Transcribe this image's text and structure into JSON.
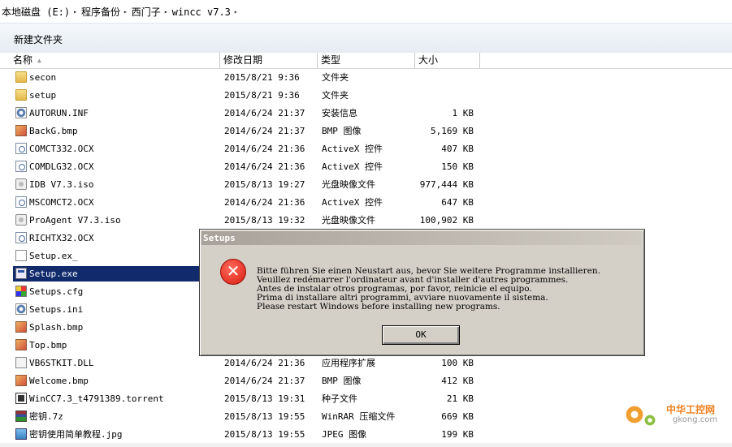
{
  "breadcrumb": [
    "本地磁盘 (E:)",
    "程序备份",
    "西门子",
    "wincc v7.3"
  ],
  "toolbar": {
    "new_folder": "新建文件夹"
  },
  "columns": {
    "name": "名称",
    "date": "修改日期",
    "type": "类型",
    "size": "大小"
  },
  "files": [
    {
      "name": "secon",
      "date": "2015/8/21 9:36",
      "type": "文件夹",
      "size": "",
      "icon": "folder-icon"
    },
    {
      "name": "setup",
      "date": "2015/8/21 9:36",
      "type": "文件夹",
      "size": "",
      "icon": "folder-icon"
    },
    {
      "name": "AUTORUN.INF",
      "date": "2014/6/24 21:37",
      "type": "安装信息",
      "size": "1 KB",
      "icon": "settings-file-icon"
    },
    {
      "name": "BackG.bmp",
      "date": "2014/6/24 21:37",
      "type": "BMP 图像",
      "size": "5,169 KB",
      "icon": "image-file-icon"
    },
    {
      "name": "COMCT332.OCX",
      "date": "2014/6/24 21:36",
      "type": "ActiveX 控件",
      "size": "407 KB",
      "icon": "activex-file-icon"
    },
    {
      "name": "COMDLG32.OCX",
      "date": "2014/6/24 21:36",
      "type": "ActiveX 控件",
      "size": "150 KB",
      "icon": "activex-file-icon"
    },
    {
      "name": "IDB V7.3.iso",
      "date": "2015/8/13 19:27",
      "type": "光盘映像文件",
      "size": "977,444 KB",
      "icon": "disc-image-icon"
    },
    {
      "name": "MSCOMCT2.OCX",
      "date": "2014/6/24 21:36",
      "type": "ActiveX 控件",
      "size": "647 KB",
      "icon": "activex-file-icon"
    },
    {
      "name": "ProAgent V7.3.iso",
      "date": "2015/8/13 19:32",
      "type": "光盘映像文件",
      "size": "100,902 KB",
      "icon": "disc-image-icon"
    },
    {
      "name": "RICHTX32.OCX",
      "date": "",
      "type": "",
      "size": "",
      "icon": "activex-file-icon"
    },
    {
      "name": "Setup.ex_",
      "date": "",
      "type": "",
      "size": "",
      "icon": "blank-file-icon"
    },
    {
      "name": "Setup.exe",
      "date": "",
      "type": "",
      "size": "",
      "icon": "exe-file-icon",
      "selected": true
    },
    {
      "name": "Setups.cfg",
      "date": "",
      "type": "",
      "size": "",
      "icon": "config-file-icon"
    },
    {
      "name": "Setups.ini",
      "date": "",
      "type": "",
      "size": "",
      "icon": "settings-file-icon"
    },
    {
      "name": "Splash.bmp",
      "date": "",
      "type": "",
      "size": "",
      "icon": "image-file-icon"
    },
    {
      "name": "Top.bmp",
      "date": "",
      "type": "",
      "size": "",
      "icon": "image-file-icon"
    },
    {
      "name": "VB6STKIT.DLL",
      "date": "2014/6/24 21:36",
      "type": "应用程序扩展",
      "size": "100 KB",
      "icon": "dll-file-icon"
    },
    {
      "name": "Welcome.bmp",
      "date": "2014/6/24 21:37",
      "type": "BMP 图像",
      "size": "412 KB",
      "icon": "image-file-icon"
    },
    {
      "name": "WinCC7.3_t4791389.torrent",
      "date": "2015/8/13 19:31",
      "type": "种子文件",
      "size": "21 KB",
      "icon": "torrent-file-icon"
    },
    {
      "name": "密钥.7z",
      "date": "2015/8/13 19:55",
      "type": "WinRAR 压缩文件",
      "size": "669 KB",
      "icon": "archive-file-icon"
    },
    {
      "name": "密钥使用简单教程.jpg",
      "date": "2015/8/13 19:55",
      "type": "JPEG 图像",
      "size": "199 KB",
      "icon": "jpeg-file-icon"
    }
  ],
  "dialog": {
    "title": "Setups",
    "messages": [
      "Bitte führen Sie einen Neustart aus, bevor Sie weitere Programme installieren.",
      "Veuillez redémarrer l'ordinateur avant d'installer d'autres programmes.",
      "Antes de instalar otros programas, por favor, reinicie el equipo.",
      "Prima di installare altri programmi, avviare nuovamente il sistema.",
      "Please restart Windows before installing new programs."
    ],
    "ok": "OK"
  },
  "watermark": {
    "text": "中华工控网",
    "sub": "gkong.com"
  },
  "colors": {
    "selection": "#102a6b",
    "dialog_bg": "#d4d0c8",
    "error": "#d81c10"
  }
}
